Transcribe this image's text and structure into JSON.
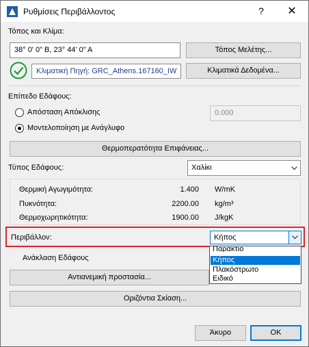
{
  "window": {
    "title": "Ρυθμίσεις Περιβάλλοντος",
    "help_glyph": "?",
    "close_glyph": "✕"
  },
  "location": {
    "section_label": "Τόπος και Κλίμα:",
    "coordinates": "38° 0' 0\" B, 23° 44' 0\" A",
    "project_location_button": "Τόπος Μελέτης...",
    "climate_source": "Κλιματική Πηγή: GRC_Athens.167160_IW",
    "climate_data_button": "Κλιματικά Δεδομένα..."
  },
  "ground": {
    "level_label": "Επίπεδο Εδάφους:",
    "offset_option": "Απόσταση Απόκλισης",
    "offset_value": "0.000",
    "terrain_option": "Μοντελοποίηση με Ανάγλυφο",
    "surface_temp_button": "Θερμοπερατότητα Επιφάνειας...",
    "type_label": "Τύπος Εδάφους:",
    "type_value": "Χαλίκι",
    "properties": [
      {
        "label": "Θερμική Αγωγιμότητα:",
        "value": "1.400",
        "unit": "W/mK"
      },
      {
        "label": "Πυκνότητα:",
        "value": "2200.00",
        "unit": "kg/m³"
      },
      {
        "label": "Θερμοχωρητικότητα:",
        "value": "1900.00",
        "unit": "J/kgK"
      }
    ]
  },
  "surroundings": {
    "label": "Περιβάλλον:",
    "value": "Κήπος",
    "options": [
      "Παράκτιο",
      "Κήπος",
      "Πλακόστρωτο",
      "Ειδικό"
    ],
    "selected_index": 1
  },
  "reflection_label": "Ανάκλαση Εδάφους",
  "glare_button": "Αντιανεμική προστασία...",
  "horizon_button": "Οριζόντια Σκίαση...",
  "footer": {
    "cancel": "Άκυρο",
    "ok": "OK"
  },
  "colors": {
    "accent": "#0078d7",
    "highlight_border": "#d9262b",
    "check_green": "#1a9b3a",
    "icon_blue": "#1f5fa8"
  }
}
